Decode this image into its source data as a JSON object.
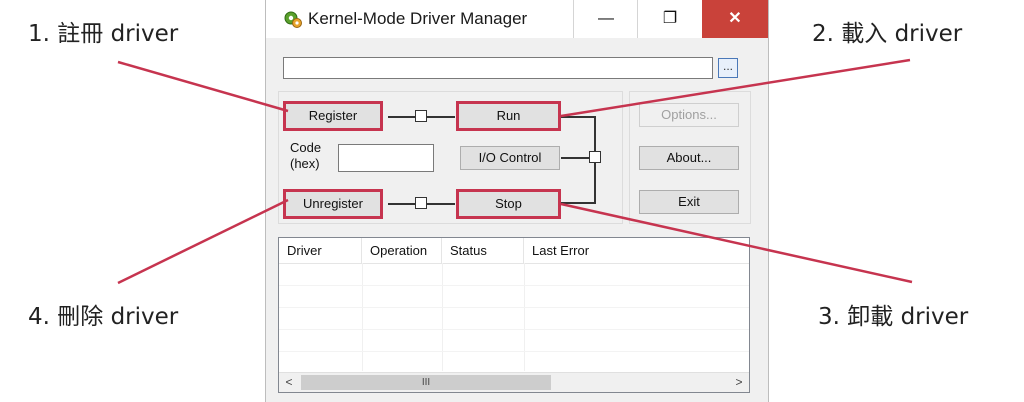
{
  "annotations": {
    "step1": "1. 註冊 driver",
    "step2": "2. 載入 driver",
    "step3": "3. 卸載 driver",
    "step4": "4. 刪除 driver"
  },
  "window": {
    "title": "Kernel-Mode Driver Manager",
    "minimize_glyph": "—",
    "maximize_glyph": "❐",
    "close_glyph": "✕"
  },
  "path_field": {
    "value": "",
    "browse_label": "..."
  },
  "buttons": {
    "register": "Register",
    "run": "Run",
    "io_control": "I/O Control",
    "unregister": "Unregister",
    "stop": "Stop",
    "options": "Options...",
    "about": "About...",
    "exit": "Exit"
  },
  "code_field": {
    "label_line1": "Code",
    "label_line2": "(hex)",
    "value": ""
  },
  "listview": {
    "columns": [
      "Driver",
      "Operation",
      "Status",
      "Last Error"
    ],
    "rows": [],
    "scroll_left": "<",
    "scroll_right": ">",
    "thumb_grip": "III"
  },
  "colors": {
    "highlight": "#c6344f",
    "close_button": "#c9423a"
  },
  "icons": {
    "app": "driver-manager-icon"
  }
}
